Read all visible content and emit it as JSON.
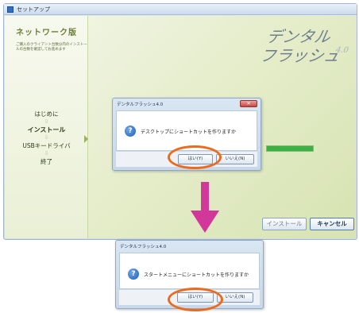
{
  "window": {
    "title": "セットアップ"
  },
  "sidebar": {
    "edition": "ネットワーク版",
    "description": "ご購入のクライアント台数分内のインストールの台数を確認してお進めます",
    "steps": [
      {
        "label": "はじめに"
      },
      {
        "label": "インストール"
      },
      {
        "label": "USBキードライバ"
      },
      {
        "label": "終了"
      }
    ]
  },
  "logo": {
    "line1": "デンタル",
    "line2": "フラッシュ",
    "version": "4.0"
  },
  "install_progress": 1.0,
  "footer": {
    "install_label": "インストール",
    "cancel_label": "キャンセル"
  },
  "dialog1": {
    "title": "デンタルフラッシュ4.0",
    "message": "デスクトップにショートカットを作りますか",
    "yes_label": "はい(Y)",
    "no_label": "いいえ(N)"
  },
  "dialog2": {
    "title": "デンタルフラッシュ4.0",
    "message": "スタートメニューにショートカットを作りますか",
    "yes_label": "はい(Y)",
    "no_label": "いいえ(N)"
  },
  "icons": {
    "question": "?",
    "arrow": "⇩",
    "close": "✕"
  },
  "colors": {
    "highlight": "#ec6a1c",
    "arrow": "#d2389a",
    "progress": "#3cb043"
  }
}
